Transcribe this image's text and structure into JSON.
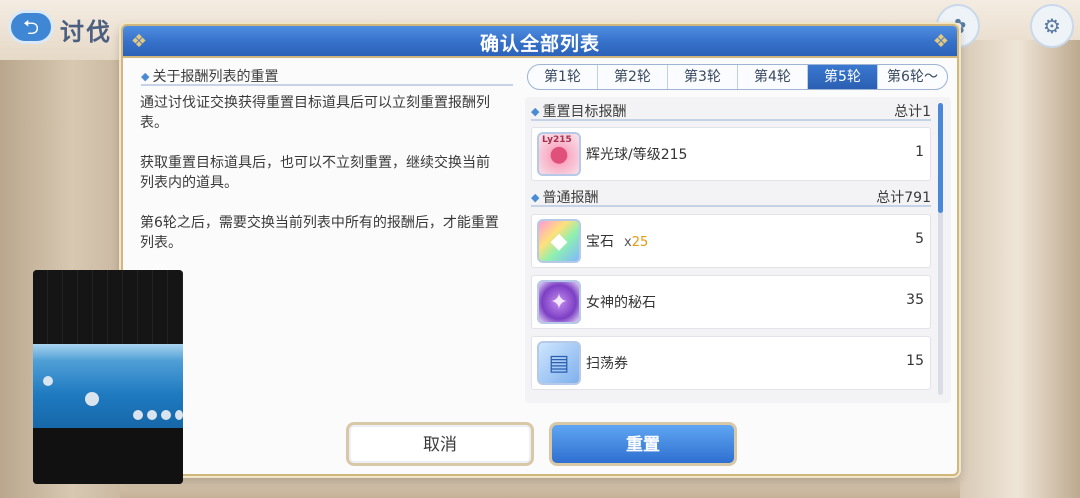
{
  "background": {
    "title": "讨伐",
    "back_icon": "back-arrow-icon"
  },
  "dialog": {
    "title": "确认全部列表",
    "info": {
      "heading": "关于报酬列表的重置",
      "paragraphs": [
        "通过讨伐证交换获得重置目标道具后可以立刻重置报酬列表。",
        "获取重置目标道具后，也可以不立刻重置，继续交换当前列表内的道具。",
        "第6轮之后，需要交换当前列表中所有的报酬后，才能重置列表。"
      ]
    },
    "tabs": [
      {
        "label": "第1轮",
        "active": false
      },
      {
        "label": "第2轮",
        "active": false
      },
      {
        "label": "第3轮",
        "active": false
      },
      {
        "label": "第4轮",
        "active": false
      },
      {
        "label": "第5轮",
        "active": true
      },
      {
        "label": "第6轮～",
        "active": false
      }
    ],
    "reset_target": {
      "heading": "重置目标报酬",
      "total": "总计1",
      "items": [
        {
          "name": "辉光球/等级215",
          "level_badge": "Ly215",
          "count": "1",
          "icon": "glow-orb-icon"
        }
      ]
    },
    "normal_rewards": {
      "heading": "普通报酬",
      "total": "总计791",
      "items": [
        {
          "name": "宝石",
          "multiplier_prefix": "x",
          "multiplier": "25",
          "count": "5",
          "icon": "gem-icon"
        },
        {
          "name": "女神的秘石",
          "count": "35",
          "icon": "goddess-stone-icon"
        },
        {
          "name": "扫荡券",
          "count": "15",
          "icon": "sweep-ticket-icon"
        }
      ]
    },
    "buttons": {
      "cancel": "取消",
      "reset": "重置"
    }
  },
  "colors": {
    "header_blue": "#3570c9",
    "gold_border": "#d1b67e",
    "accent_orange": "#e39a13"
  }
}
